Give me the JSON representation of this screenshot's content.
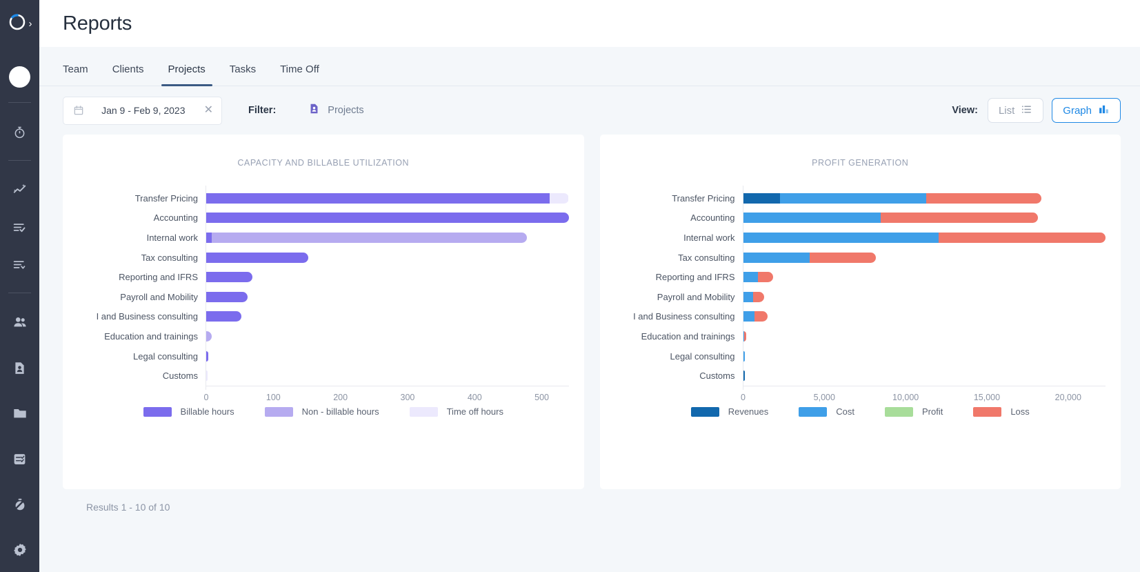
{
  "app": {
    "logo_icon": "circular-progress-logo",
    "expand_icon": "chevron-right-icon",
    "avatar_icon": "user-avatar"
  },
  "sidebar": {
    "items": [
      {
        "icon": "stopwatch-icon",
        "name": "sidebar-item-timer"
      },
      {
        "icon": "analytics-trend-icon",
        "name": "sidebar-item-analytics"
      },
      {
        "icon": "task-check-list-icon",
        "name": "sidebar-item-tasks"
      },
      {
        "icon": "list-dropdown-icon",
        "name": "sidebar-item-list"
      },
      {
        "icon": "people-icon",
        "name": "sidebar-item-team"
      },
      {
        "icon": "contact-card-icon",
        "name": "sidebar-item-clients"
      },
      {
        "icon": "folder-icon",
        "name": "sidebar-item-projects"
      },
      {
        "icon": "checklist-card-icon",
        "name": "sidebar-item-reports"
      },
      {
        "icon": "stopwatch-off-icon",
        "name": "sidebar-item-time-off"
      },
      {
        "icon": "gear-icon",
        "name": "sidebar-item-settings"
      }
    ]
  },
  "header": {
    "title": "Reports"
  },
  "tabs": [
    {
      "label": "Team",
      "active": false
    },
    {
      "label": "Clients",
      "active": false
    },
    {
      "label": "Projects",
      "active": true
    },
    {
      "label": "Tasks",
      "active": false
    },
    {
      "label": "Time Off",
      "active": false
    }
  ],
  "toolbar": {
    "date_range": "Jan 9 - Feb 9, 2023",
    "calendar_icon": "calendar-icon",
    "clear_icon": "close-x-icon",
    "filter_label": "Filter:",
    "filter_value": "Projects",
    "filter_icon": "document-person-icon",
    "view_label": "View:",
    "list_label": "List",
    "list_icon": "list-view-icon",
    "graph_label": "Graph",
    "graph_icon": "bar-chart-icon",
    "active_view": "Graph"
  },
  "footer": {
    "results": "Results 1 - 10 of 10"
  },
  "chart_data": [
    {
      "type": "bar",
      "orientation": "horizontal",
      "stacked": true,
      "title": "CAPACITY AND BILLABLE UTILIZATION",
      "xlabel": "",
      "ylabel": "",
      "xlim": [
        0,
        540
      ],
      "xticks": [
        0,
        100,
        200,
        300,
        400,
        500
      ],
      "xtick_labels": [
        "0",
        "100",
        "200",
        "300",
        "400",
        "500"
      ],
      "grid": false,
      "legend_position": "bottom",
      "categories": [
        "Transfer Pricing",
        "Accounting",
        "Internal work",
        "Tax consulting",
        "Reporting and  IFRS",
        "Payroll and Mobility",
        "I and Business consulting",
        "Education and trainings",
        "Legal consulting",
        "Customs"
      ],
      "series": [
        {
          "name": "Billable hours",
          "color": "#7b6ced",
          "values": [
            533,
            561,
            8,
            152,
            69,
            62,
            52,
            0,
            3,
            0
          ]
        },
        {
          "name": "Non - billable hours",
          "color": "#b6abf0",
          "values": [
            0,
            0,
            470,
            0,
            0,
            0,
            0,
            8,
            0,
            0
          ]
        },
        {
          "name": "Time off hours",
          "color": "#ece9fd",
          "values": [
            29,
            0,
            0,
            0,
            0,
            0,
            0,
            0,
            0,
            1
          ]
        }
      ]
    },
    {
      "type": "bar",
      "orientation": "horizontal",
      "stacked": true,
      "title": "PROFIT GENERATION",
      "xlabel": "",
      "ylabel": "",
      "xlim": [
        0,
        22300
      ],
      "xticks": [
        0,
        5000,
        10000,
        15000,
        20000
      ],
      "xtick_labels": [
        "0",
        "5,000",
        "10,000",
        "15,000",
        "20,000"
      ],
      "grid": false,
      "legend_position": "bottom",
      "categories": [
        "Transfer Pricing",
        "Accounting",
        "Internal work",
        "Tax consulting",
        "Reporting and  IFRS",
        "Payroll and Mobility",
        "I and Business consulting",
        "Education and trainings",
        "Legal consulting",
        "Customs"
      ],
      "series": [
        {
          "name": "Revenues",
          "color": "#1268ad",
          "values": [
            2250,
            0,
            0,
            0,
            0,
            0,
            0,
            0,
            0,
            0
          ]
        },
        {
          "name": "Cost",
          "color": "#3f9fe8",
          "values": [
            9000,
            8450,
            12400,
            4100,
            900,
            600,
            700,
            80,
            40,
            0
          ]
        },
        {
          "name": "Profit",
          "color": "#a8dd9a",
          "values": [
            0,
            0,
            0,
            0,
            0,
            0,
            0,
            0,
            0,
            0
          ]
        },
        {
          "name": "Loss",
          "color": "#f0786a",
          "values": [
            7100,
            9700,
            10550,
            4050,
            950,
            700,
            800,
            120,
            0,
            0
          ]
        }
      ]
    }
  ]
}
